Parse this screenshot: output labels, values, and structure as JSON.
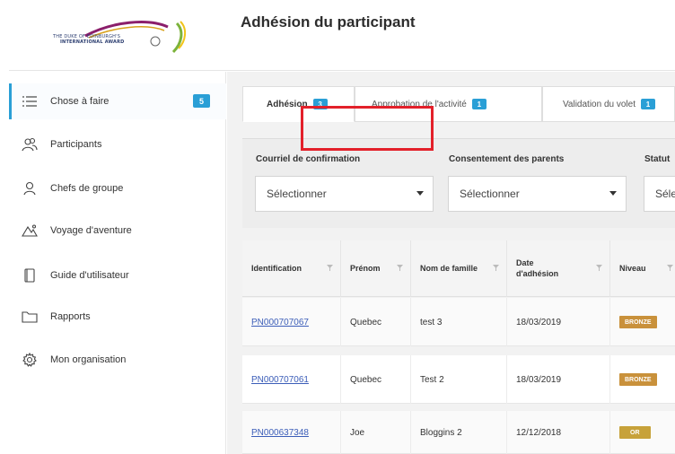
{
  "header": {
    "logo_text_line1": "THE DUKE OF EDINBURGH'S",
    "logo_text_line2": "INTERNATIONAL AWARD",
    "title": "Adhésion du participant"
  },
  "sidebar": {
    "items": [
      {
        "label": "Chose à faire",
        "icon": "list-icon",
        "badge": "5"
      },
      {
        "label": "Participants",
        "icon": "people-icon"
      },
      {
        "label": "Chefs de groupe",
        "icon": "person-icon"
      },
      {
        "label": "Voyage d'aventure",
        "icon": "mountain-icon"
      },
      {
        "label": "Guide d'utilisateur",
        "icon": "book-icon"
      },
      {
        "label": "Rapports",
        "icon": "folder-icon"
      },
      {
        "label": "Mon organisation",
        "icon": "gear-icon"
      }
    ]
  },
  "tabs": [
    {
      "label": "Adhésion",
      "badge": "3"
    },
    {
      "label": "Approbation de l'activité",
      "badge": "1"
    },
    {
      "label": "Validation du volet",
      "badge": "1"
    }
  ],
  "filters": [
    {
      "label": "Courriel de confirmation",
      "value": "Sélectionner"
    },
    {
      "label": "Consentement des parents",
      "value": "Sélectionner"
    },
    {
      "label": "Statut",
      "value": "Séle"
    }
  ],
  "table": {
    "headers": [
      "Identification",
      "Prénom",
      "Nom de famille",
      "Date d'adhésion",
      "Niveau"
    ],
    "rows": [
      {
        "id": "PN000707067",
        "first": "Quebec",
        "last": "test 3",
        "date": "18/03/2019",
        "level": "BRONZE",
        "level_color": "#c9913b"
      },
      {
        "id": "PN000707061",
        "first": "Quebec",
        "last": "Test 2",
        "date": "18/03/2019",
        "level": "BRONZE",
        "level_color": "#c9913b"
      },
      {
        "id": "PN000637348",
        "first": "Joe",
        "last": "Bloggins 2",
        "date": "12/12/2018",
        "level": "OR",
        "level_color": "#c7a23a"
      }
    ]
  },
  "colors": {
    "accent": "#2a9fd6",
    "highlight": "#e3202a"
  }
}
